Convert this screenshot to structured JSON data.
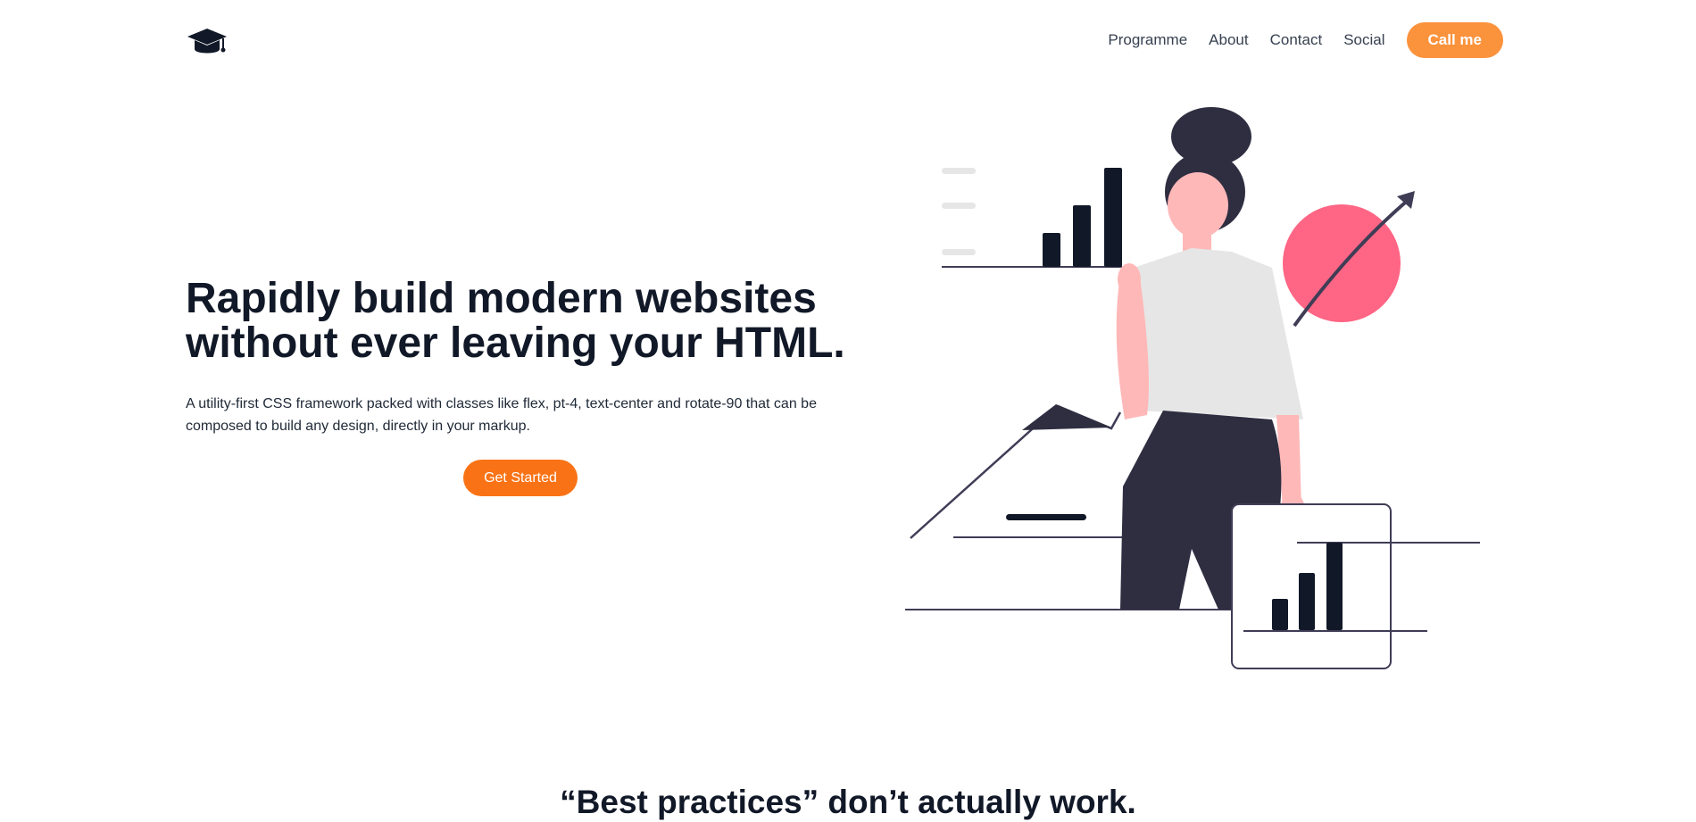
{
  "nav": {
    "logo_icon": "graduation-cap-icon",
    "links": [
      {
        "label": "Programme"
      },
      {
        "label": "About"
      },
      {
        "label": "Contact"
      },
      {
        "label": "Social"
      }
    ],
    "cta_label": "Call me"
  },
  "hero": {
    "title": "Rapidly build modern websites without ever leaving your HTML.",
    "description": "A utility-first CSS framework packed with classes like flex, pt-4, text-center and rotate-90 that can be composed to build any design, directly in your markup.",
    "button_label": "Get Started",
    "illustration": "woman-with-charts-illustration"
  },
  "section": {
    "heading": "“Best practices” don’t actually work."
  },
  "colors": {
    "accent_orange": "#f97316",
    "nav_button_orange": "#fb923c",
    "text_dark": "#111827",
    "illustration_dark": "#2f2e41",
    "illustration_pink": "#ff6584"
  }
}
